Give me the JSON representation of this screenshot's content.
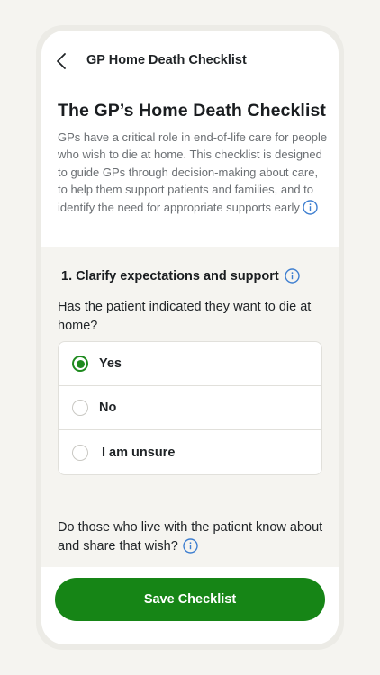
{
  "header": {
    "back_icon": "chevron-left-icon",
    "title": "GP Home Death Checklist"
  },
  "intro": {
    "heading": "The GP’s Home Death Checklist",
    "description": "GPs have a critical role in end-of-life care for people who wish to die at home. This checklist is designed to guide GPs through decision-making about care, to help them support patients and families, and to identify the need for appropriate supports early",
    "info_icon": "info-icon"
  },
  "section": {
    "title": "1. Clarify expectations and support",
    "questions": [
      {
        "text": "Has the patient indicated they want to die at home?",
        "options": [
          {
            "label": "Yes",
            "selected": true
          },
          {
            "label": "No",
            "selected": false
          },
          {
            "label": "I am unsure",
            "selected": false
          }
        ]
      },
      {
        "text": "Do those who live with the patient know about and share that wish?"
      }
    ]
  },
  "footer": {
    "save_label": "Save Checklist"
  },
  "colors": {
    "accent": "#168516",
    "info": "#3f7fd0"
  }
}
